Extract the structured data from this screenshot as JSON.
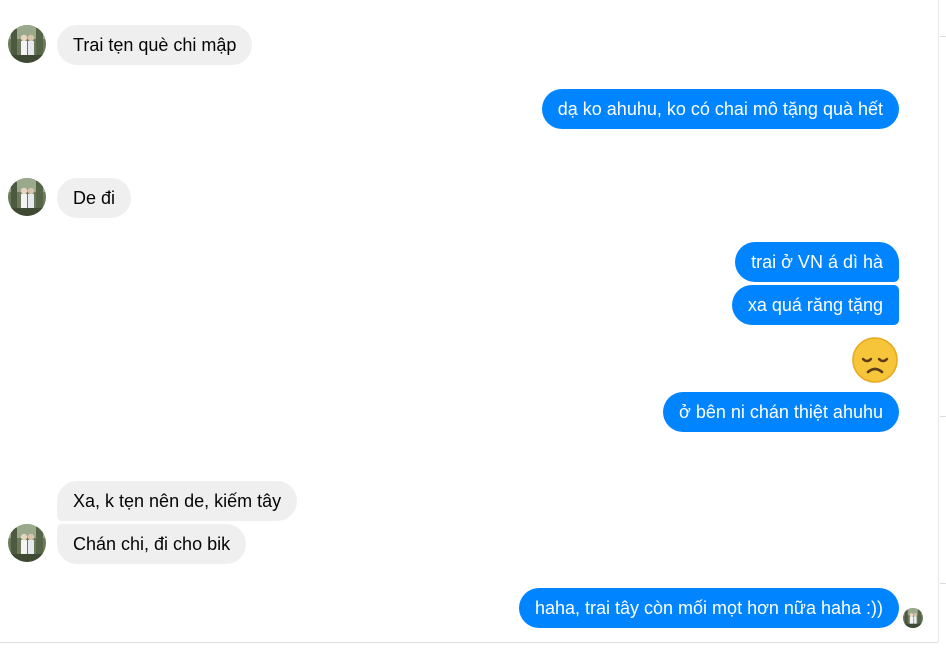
{
  "messages": [
    {
      "side": "incoming",
      "text": "Trai tẹn què chi mập"
    },
    {
      "side": "outgoing",
      "text": "dạ ko ahuhu, ko có chai mô tặng quà hết"
    },
    {
      "side": "incoming",
      "text": "De đi"
    },
    {
      "side": "outgoing",
      "text": "trai ở VN á dì hà"
    },
    {
      "side": "outgoing",
      "text": "xa quá răng tặng"
    },
    {
      "side": "outgoing",
      "type": "emoji",
      "emoji": "disappointed-face-icon"
    },
    {
      "side": "outgoing",
      "text": "ở bên ni chán thiệt ahuhu"
    },
    {
      "side": "incoming",
      "text": "Xa, k tẹn nên de, kiếm tây"
    },
    {
      "side": "incoming",
      "text": "Chán chi, đi cho bik"
    },
    {
      "side": "outgoing",
      "text": "haha, trai tây còn mối mọt hơn nữa haha :))"
    }
  ],
  "colors": {
    "outgoing_bubble": "#0084ff",
    "incoming_bubble": "#efefef",
    "outgoing_text": "#ffffff",
    "incoming_text": "#050505"
  }
}
